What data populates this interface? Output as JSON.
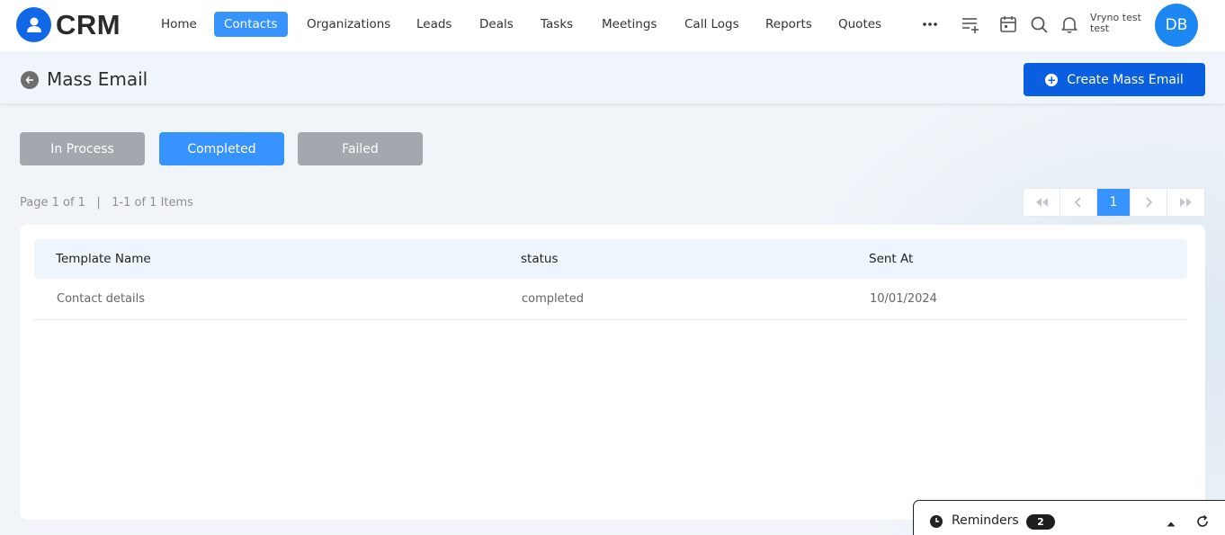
{
  "app": {
    "logo_text": "CRM"
  },
  "nav": {
    "items": [
      {
        "label": "Home"
      },
      {
        "label": "Contacts"
      },
      {
        "label": "Organizations"
      },
      {
        "label": "Leads"
      },
      {
        "label": "Deals"
      },
      {
        "label": "Tasks"
      },
      {
        "label": "Meetings"
      },
      {
        "label": "Call Logs"
      },
      {
        "label": "Reports"
      },
      {
        "label": "Quotes"
      }
    ],
    "active": "Contacts",
    "more_icon": "more-horizontal-icon",
    "icons": [
      "add-list-icon",
      "calendar-icon",
      "search-icon",
      "bell-icon"
    ]
  },
  "user": {
    "name_line1": "Vryno test",
    "name_line2": "test",
    "initials": "DB"
  },
  "page": {
    "title": "Mass Email",
    "create_button": "Create Mass Email"
  },
  "status_tabs": [
    {
      "label": "In Process"
    },
    {
      "label": "Completed"
    },
    {
      "label": "Failed"
    }
  ],
  "active_status_tab": "Completed",
  "pagination": {
    "page_label": "Page 1 of 1",
    "items_label": "1-1 of 1 Items",
    "current_page": "1"
  },
  "table": {
    "columns": [
      "Template Name",
      "status",
      "Sent At"
    ],
    "rows": [
      [
        "Contact details",
        "completed",
        "10/01/2024"
      ]
    ]
  },
  "reminders": {
    "label": "Reminders",
    "count": "2"
  },
  "colors": {
    "primary": "#3793ff",
    "brand": "#1168e6",
    "button_dark": "#0a5fe0",
    "tab_inactive": "#a3a7ae"
  }
}
